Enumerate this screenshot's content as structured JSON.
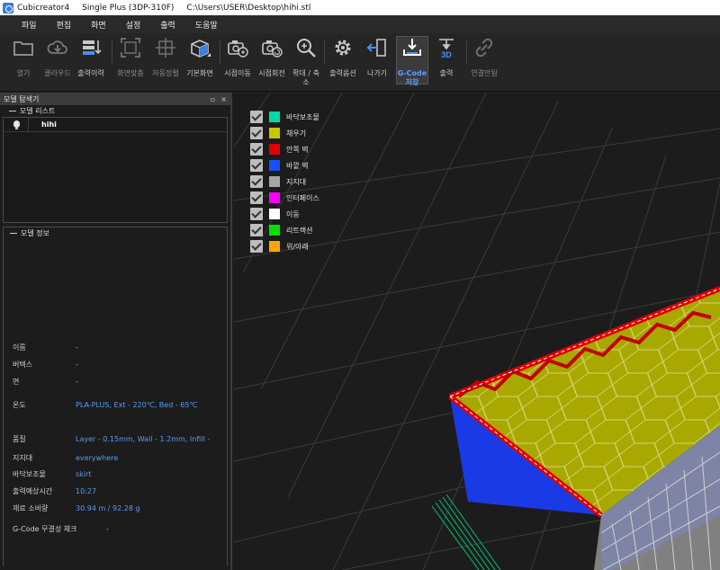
{
  "window": {
    "app": "Cubicreator4",
    "printer": "Single Plus (3DP-310F)",
    "path": "C:\\Users\\USER\\Desktop\\hihi.stl"
  },
  "menu": [
    "파일",
    "편집",
    "화면",
    "설정",
    "출력",
    "도움말"
  ],
  "toolbar": {
    "open": "열기",
    "cloud": "클라우드",
    "history": "출력이력",
    "fit": "화면맞춤",
    "autoplace": "자동정렬",
    "default_view": "기본화면",
    "move": "시점이동",
    "rotate": "시점회전",
    "zoom_line1": "확대 / 축",
    "zoom_line2": "소",
    "options": "출력옵션",
    "exit": "나가기",
    "gcode_line1": "G-Code",
    "gcode_line2": "저장",
    "print": "출력",
    "connect": "연결안됨"
  },
  "panel": {
    "title": "모델 탐색기",
    "pin": "♫",
    "close": "×",
    "list_title": "모델 리스트",
    "models": [
      {
        "name": "hihi"
      }
    ],
    "info_title": "모델 정보",
    "info": [
      {
        "key": "이름",
        "value": "-"
      },
      {
        "key": "버텍스",
        "value": "-"
      },
      {
        "key": "면",
        "value": "-"
      },
      {
        "key": "온도",
        "value": "PLA-PLUS, Ext - 220℃, Bed - 65℃"
      },
      {
        "key": "품질",
        "value": "Layer - 0.15mm, Wall - 1.2mm, Infill -"
      },
      {
        "key": "지지대",
        "value": "everywhere"
      },
      {
        "key": "바닥보조물",
        "value": "skirt"
      },
      {
        "key": "출력예상시간",
        "value": "10:27"
      },
      {
        "key": "재료 소비량",
        "value": "30.94 m / 92.28 g"
      },
      {
        "key": "G-Code 무결성 체크",
        "value": "-"
      }
    ]
  },
  "legend": [
    {
      "label": "바닥보조물",
      "color": "#00d8a8"
    },
    {
      "label": "채우기",
      "color": "#c8c800"
    },
    {
      "label": "안쪽 벽",
      "color": "#e00000"
    },
    {
      "label": "바깥 벽",
      "color": "#1a4fff"
    },
    {
      "label": "지지대",
      "color": "#a6a6a6"
    },
    {
      "label": "인터페이스",
      "color": "#ff00ff"
    },
    {
      "label": "이동",
      "color": "#ffffff"
    },
    {
      "label": "리트랙션",
      "color": "#00e000"
    },
    {
      "label": "위/아래",
      "color": "#ffa500"
    }
  ]
}
